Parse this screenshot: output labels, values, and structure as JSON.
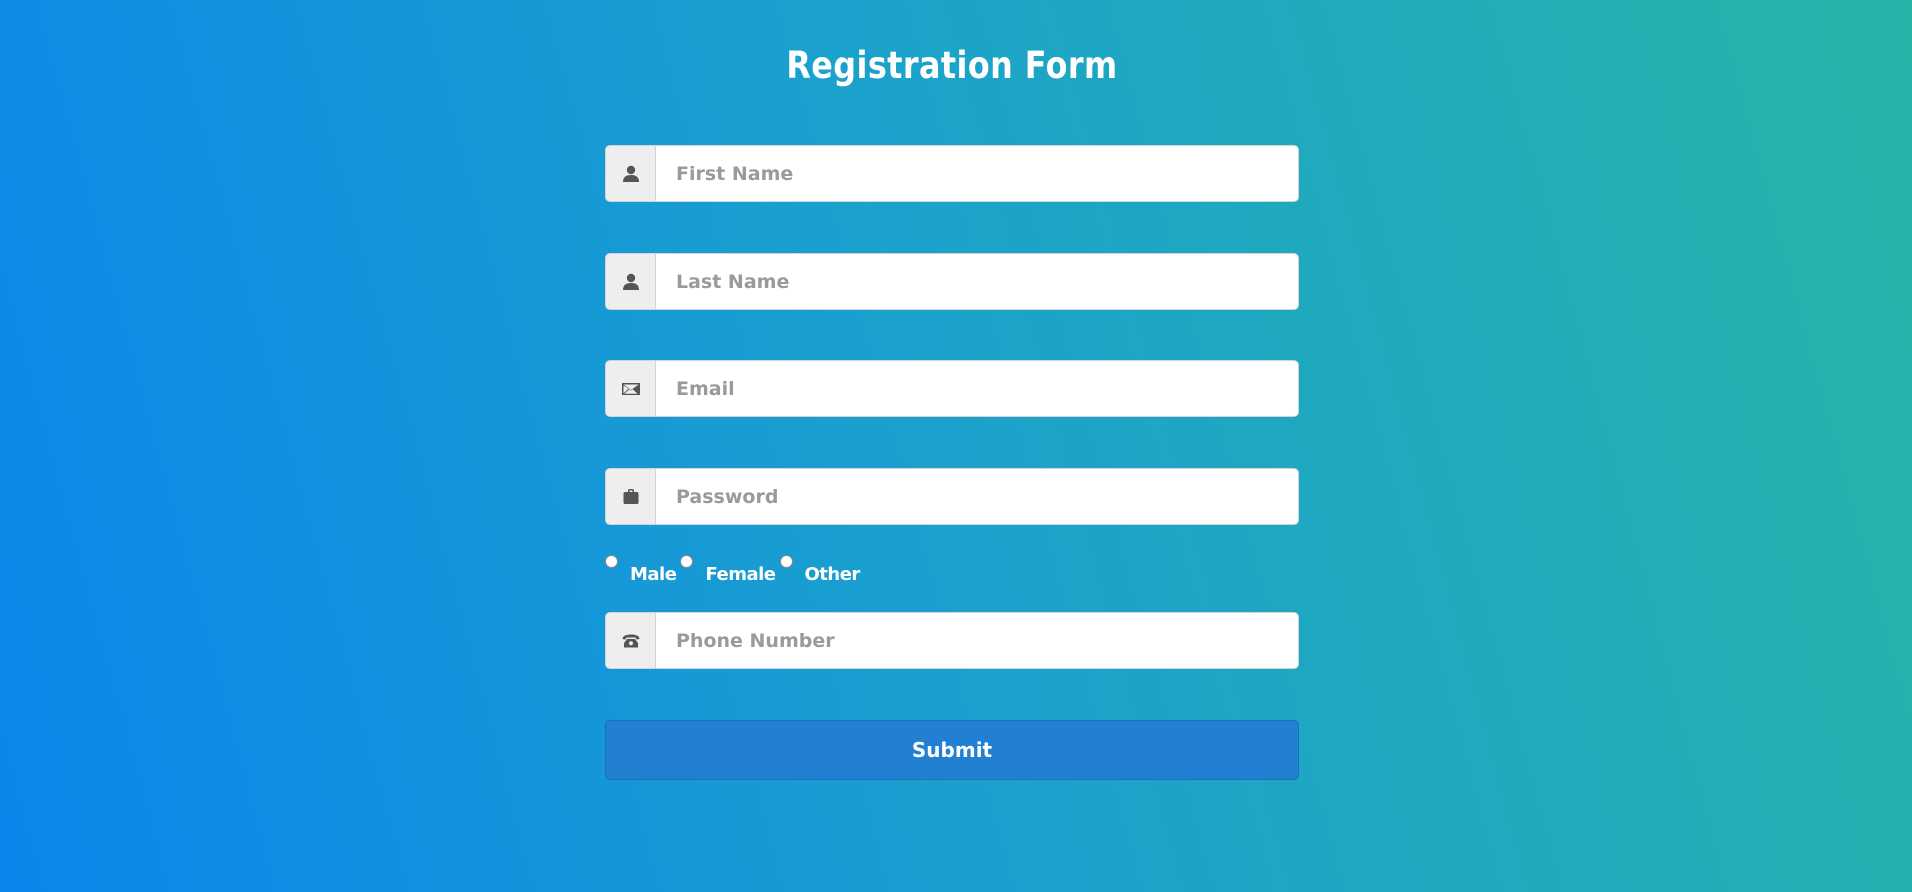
{
  "form": {
    "title": "Registration Form",
    "fields": {
      "first_name": {
        "placeholder": "First Name",
        "icon": "user-icon"
      },
      "last_name": {
        "placeholder": "Last Name",
        "icon": "user-icon"
      },
      "email": {
        "placeholder": "Email",
        "icon": "envelope-icon"
      },
      "password": {
        "placeholder": "Password",
        "icon": "lock-icon"
      },
      "phone": {
        "placeholder": "Phone Number",
        "icon": "phone-icon"
      }
    },
    "gender_options": [
      "Male",
      "Female",
      "Other"
    ],
    "submit_label": "Submit"
  },
  "colors": {
    "gradient_start": "#0a86ec",
    "gradient_end": "#25b5a8",
    "button": "#2180d1",
    "addon_bg": "#eeeeee"
  }
}
